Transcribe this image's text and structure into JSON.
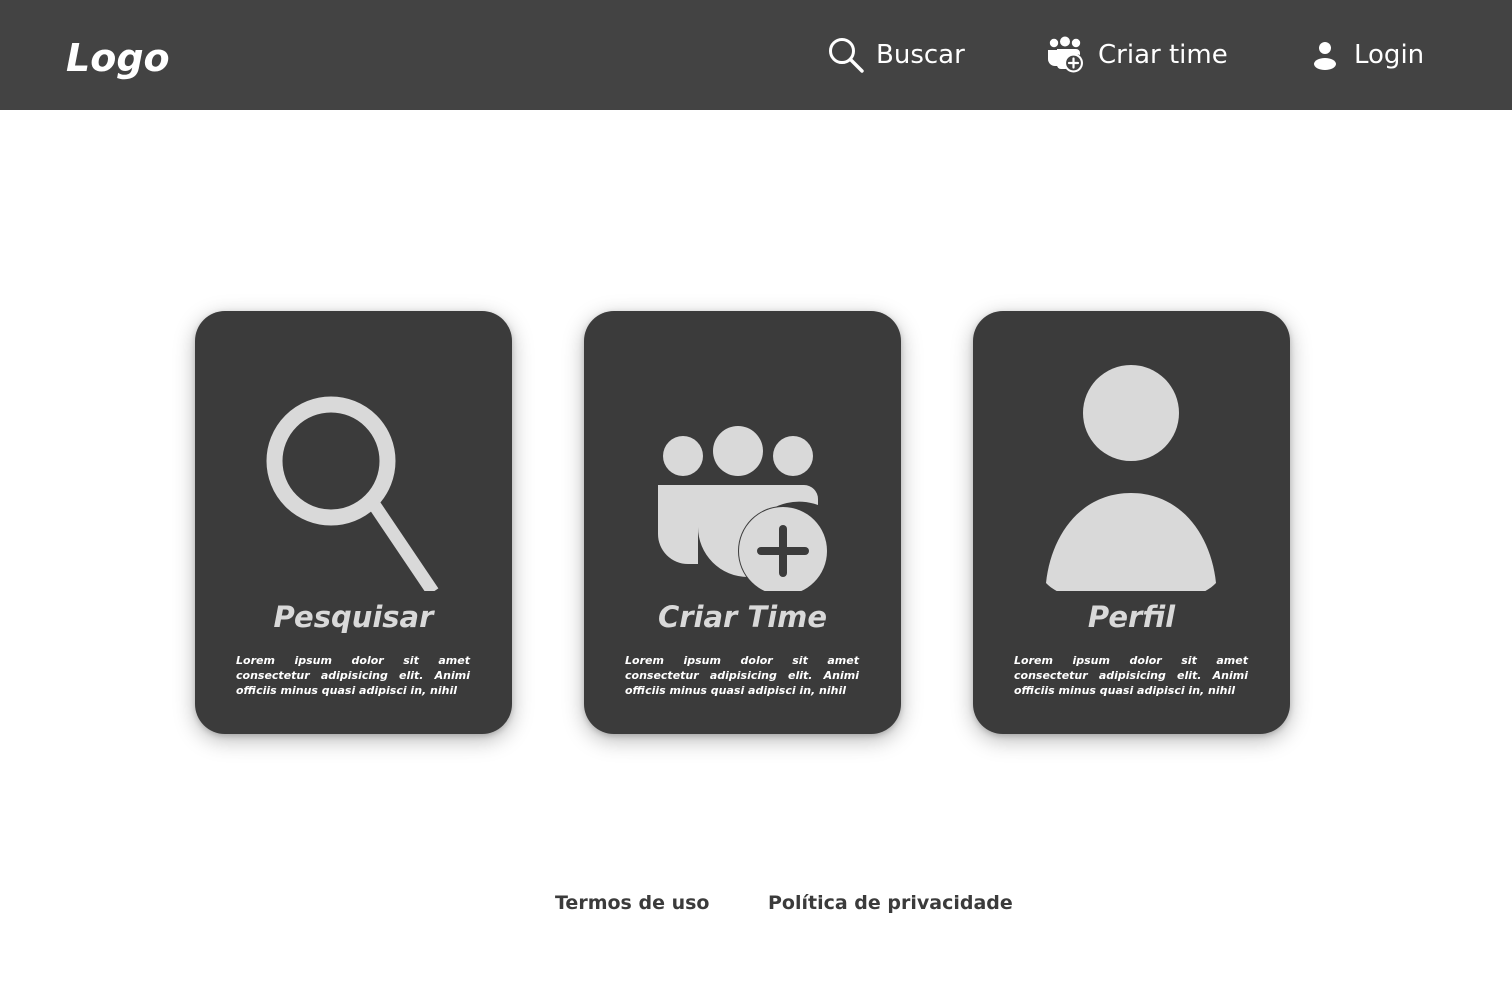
{
  "header": {
    "logo": "Logo",
    "nav": {
      "search_label": "Buscar",
      "create_team_label": "Criar time",
      "login_label": "Login"
    }
  },
  "cards": [
    {
      "title": "Pesquisar",
      "description": "Lorem ipsum dolor sit amet consectetur adipisicing elit. Animi officiis minus quasi adipisci in, nihil",
      "icon": "search-icon"
    },
    {
      "title": "Criar Time",
      "description": "Lorem ipsum dolor sit amet consectetur adipisicing elit. Animi officiis minus quasi adipisci in, nihil",
      "icon": "team-add-icon"
    },
    {
      "title": "Perfil",
      "description": "Lorem ipsum dolor sit amet consectetur adipisicing elit. Animi officiis minus quasi adipisci in, nihil",
      "icon": "user-icon"
    }
  ],
  "footer": {
    "terms_label": "Termos de uso",
    "privacy_label": "Política de privacidade"
  },
  "colors": {
    "navbar_bg": "#434343",
    "card_bg": "#3b3b3b",
    "icon_fill": "#d9d9d9",
    "text_light": "#ffffff",
    "footer_text": "#3b3b3b"
  }
}
